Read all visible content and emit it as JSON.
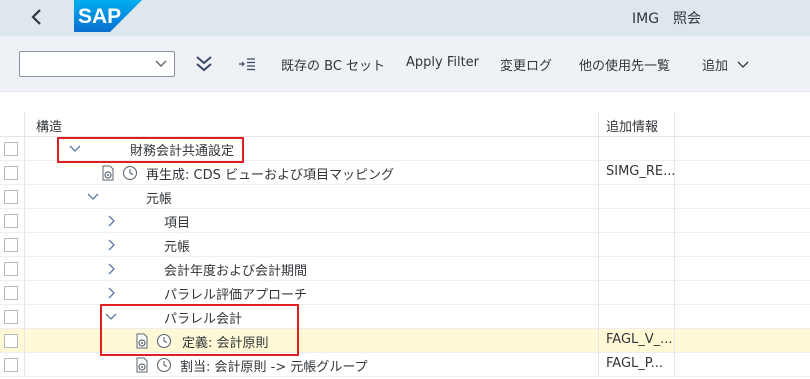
{
  "shell": {
    "logo_text": "SAP",
    "title": "IMG　照会",
    "brand_color": "#0a6ed1"
  },
  "toolbar": {
    "variant_select_value": "",
    "expand_icon": "double-chevron-down-icon",
    "position_icon": "find-position-icon",
    "existing_bc_sets": "既存の BC セット",
    "apply_filter": "Apply Filter",
    "change_log": "変更ログ",
    "where_used": "他の使用先一覧",
    "more": "追加"
  },
  "table": {
    "headers": {
      "structure": "構造",
      "additional_info": "追加情報"
    },
    "rows": [
      {
        "label": "財務会計共通設定",
        "info": "",
        "expanded": true,
        "has_toggle": true,
        "has_icons": false,
        "selected": false
      },
      {
        "label": "再生成: CDS ビューおよび項目マッピング",
        "info": "SIMG_RE...",
        "expanded": false,
        "has_toggle": false,
        "has_icons": true,
        "selected": false
      },
      {
        "label": "元帳",
        "info": "",
        "expanded": true,
        "has_toggle": true,
        "has_icons": false,
        "selected": false
      },
      {
        "label": "項目",
        "info": "",
        "expanded": false,
        "has_toggle": true,
        "has_icons": false,
        "selected": false
      },
      {
        "label": "元帳",
        "info": "",
        "expanded": false,
        "has_toggle": true,
        "has_icons": false,
        "selected": false
      },
      {
        "label": "会計年度および会計期間",
        "info": "",
        "expanded": false,
        "has_toggle": true,
        "has_icons": false,
        "selected": false
      },
      {
        "label": "パラレル評価アプローチ",
        "info": "",
        "expanded": false,
        "has_toggle": true,
        "has_icons": false,
        "selected": false
      },
      {
        "label": "パラレル会計",
        "info": "",
        "expanded": true,
        "has_toggle": true,
        "has_icons": false,
        "selected": false
      },
      {
        "label": "定義: 会計原則",
        "info": "FAGL_V_...",
        "expanded": false,
        "has_toggle": false,
        "has_icons": true,
        "selected": true
      },
      {
        "label": "割当: 会計原則 -> 元帳グループ",
        "info": "FAGL_P...",
        "expanded": false,
        "has_toggle": false,
        "has_icons": true,
        "selected": false
      }
    ]
  }
}
